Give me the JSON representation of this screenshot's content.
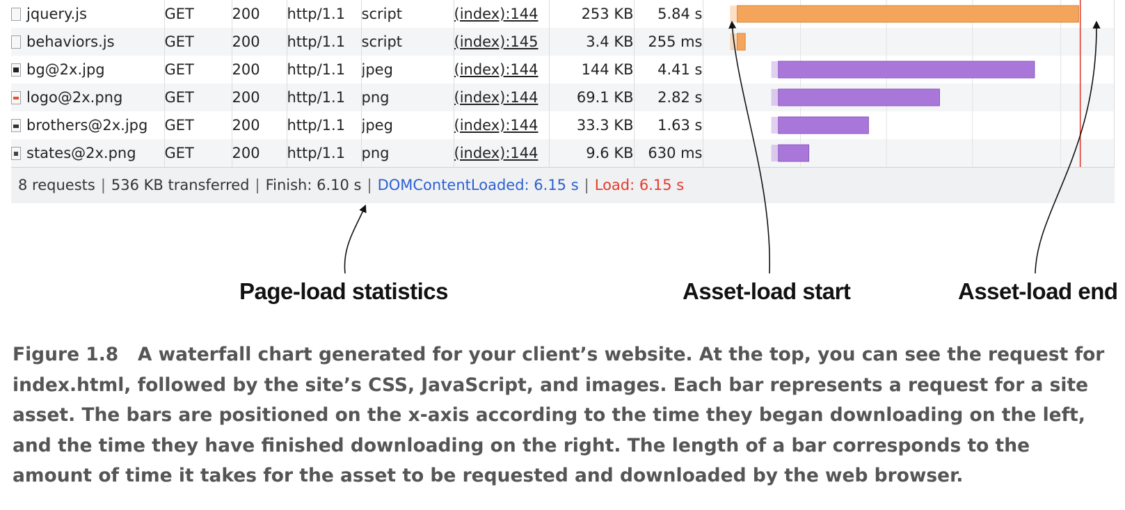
{
  "requests": [
    {
      "name": "jquery.js",
      "icon": "script-file-icon",
      "method": "GET",
      "status": "200",
      "protocol": "http/1.1",
      "type": "script",
      "initiator": "(index):144",
      "size": "253 KB",
      "time": "5.84 s",
      "bar_color": "#f5a55b"
    },
    {
      "name": "behaviors.js",
      "icon": "script-file-icon",
      "method": "GET",
      "status": "200",
      "protocol": "http/1.1",
      "type": "script",
      "initiator": "(index):145",
      "size": "3.4 KB",
      "time": "255 ms",
      "bar_color": "#f5a55b"
    },
    {
      "name": "bg@2x.jpg",
      "icon": "image-file-icon",
      "method": "GET",
      "status": "200",
      "protocol": "http/1.1",
      "type": "jpeg",
      "initiator": "(index):144",
      "size": "144 KB",
      "time": "4.41 s",
      "bar_color": "#a877d9"
    },
    {
      "name": "logo@2x.png",
      "icon": "logo-image-icon",
      "method": "GET",
      "status": "200",
      "protocol": "http/1.1",
      "type": "png",
      "initiator": "(index):144",
      "size": "69.1 KB",
      "time": "2.82 s",
      "bar_color": "#a877d9"
    },
    {
      "name": "brothers@2x.jpg",
      "icon": "photo-image-icon",
      "method": "GET",
      "status": "200",
      "protocol": "http/1.1",
      "type": "jpeg",
      "initiator": "(index):144",
      "size": "33.3 KB",
      "time": "1.63 s",
      "bar_color": "#a877d9"
    },
    {
      "name": "states@2x.png",
      "icon": "map-image-icon",
      "method": "GET",
      "status": "200",
      "protocol": "http/1.1",
      "type": "png",
      "initiator": "(index):144",
      "size": "9.6 KB",
      "time": "630 ms",
      "bar_color": "#a877d9"
    }
  ],
  "status_bar": {
    "requests": "8 requests",
    "transferred": "536 KB transferred",
    "finish": "Finish: 6.10 s",
    "dom_content_loaded": "DOMContentLoaded: 6.15 s",
    "load": "Load: 6.15 s",
    "separator": "|"
  },
  "callouts": {
    "stats": "Page-load statistics",
    "start": "Asset-load start",
    "end": "Asset-load end"
  },
  "caption": {
    "label": "Figure 1.8",
    "text": "A waterfall chart generated for your client’s website. At the top, you can see the request for index.html, followed by the site’s CSS, JavaScript, and images. Each bar represents a request for a site asset. The bars are positioned on the x-axis according to the time they began downloading on the left, and the time they have finished downloading on the right. The length of a bar corresponds to the amount of time it takes for the asset to be requested and downloaded by the web browser."
  },
  "colors": {
    "script_bar": "#f5a55b",
    "image_bar": "#a877d9",
    "dom_content_loaded": "#2b5fd1",
    "load": "#e53b2c"
  },
  "chart_data": {
    "type": "bar",
    "orientation": "horizontal-waterfall",
    "x_unit": "s",
    "xlim": [
      0,
      6.2
    ],
    "categories": [
      "jquery.js",
      "behaviors.js",
      "bg@2x.jpg",
      "logo@2x.png",
      "brothers@2x.jpg",
      "states@2x.png"
    ],
    "start": [
      0.26,
      0.26,
      0.95,
      0.95,
      0.95,
      0.95
    ],
    "durations": [
      5.84,
      0.255,
      4.41,
      2.82,
      1.63,
      0.63
    ],
    "markers": [
      {
        "name": "DOMContentLoaded",
        "x": 6.15
      },
      {
        "name": "Load",
        "x": 6.15
      }
    ]
  }
}
